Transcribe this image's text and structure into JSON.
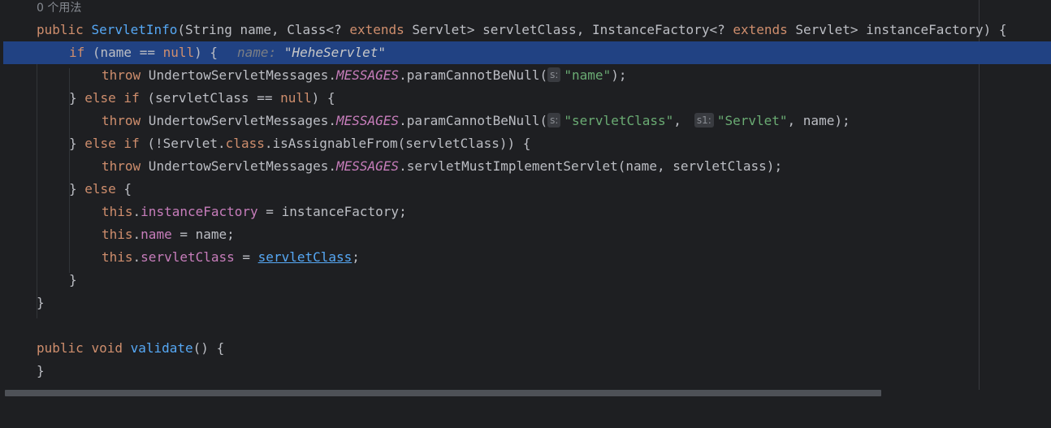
{
  "editor": {
    "usages_hint": "0 个用法",
    "lines": {
      "l1": {
        "t1": "public",
        "t2": " ",
        "t3": "ServletInfo",
        "t4": "(String name, Class<? ",
        "t5": "extends",
        "t6": " Servlet> servletClass, InstanceFactory<? ",
        "t7": "extends",
        "t8": " Servlet> instanceFactory) {"
      },
      "l2": {
        "t1": "if",
        "t2": " (name == ",
        "t3": "null",
        "t4": ") {",
        "hint_label": "name: ",
        "hint_value": "\"HeheServlet\""
      },
      "l3": {
        "t1": "throw",
        "t2": " UndertowServletMessages.",
        "t3": "MESSAGES",
        "t4": ".paramCannotBeNull(",
        "p1": "s:",
        "s1": "\"name\"",
        "t5": ");"
      },
      "l4": {
        "t1": "} ",
        "t2": "else if",
        "t3": " (servletClass == ",
        "t4": "null",
        "t5": ") {"
      },
      "l5": {
        "t1": "throw",
        "t2": " UndertowServletMessages.",
        "t3": "MESSAGES",
        "t4": ".paramCannotBeNull(",
        "p1": "s:",
        "s1": "\"servletClass\"",
        "t5": ",",
        "p2": "s1:",
        "s2": "\"Servlet\"",
        "t6": ", name);"
      },
      "l6": {
        "t1": "} ",
        "t2": "else if",
        "t3": " (!Servlet.",
        "t4": "class",
        "t5": ".isAssignableFrom(servletClass)) {"
      },
      "l7": {
        "t1": "throw",
        "t2": " UndertowServletMessages.",
        "t3": "MESSAGES",
        "t4": ".servletMustImplementServlet(name, servletClass);"
      },
      "l8": {
        "t1": "} ",
        "t2": "else",
        "t3": " {"
      },
      "l9": {
        "t1": "this",
        "t2": ".",
        "t3": "instanceFactory",
        "t4": " = instanceFactory;"
      },
      "l10": {
        "t1": "this",
        "t2": ".",
        "t3": "name",
        "t4": " = name;"
      },
      "l11": {
        "t1": "this",
        "t2": ".",
        "t3": "servletClass",
        "t4": " = ",
        "t5": "servletClass",
        "t6": ";"
      },
      "l12": {
        "t1": "}"
      },
      "l13": {
        "t1": "}"
      },
      "l15": {
        "t1": "public",
        "t2": " ",
        "t3": "void",
        "t4": " ",
        "t5": "validate",
        "t6": "() {"
      },
      "l16": {
        "t1": "}"
      }
    }
  },
  "colors": {
    "background": "#1e1f22",
    "current_line": "#214283",
    "keyword": "#cf8e6d",
    "function": "#56a8f5",
    "field": "#c77dbb",
    "string": "#6aab73",
    "text": "#bcbec4"
  }
}
